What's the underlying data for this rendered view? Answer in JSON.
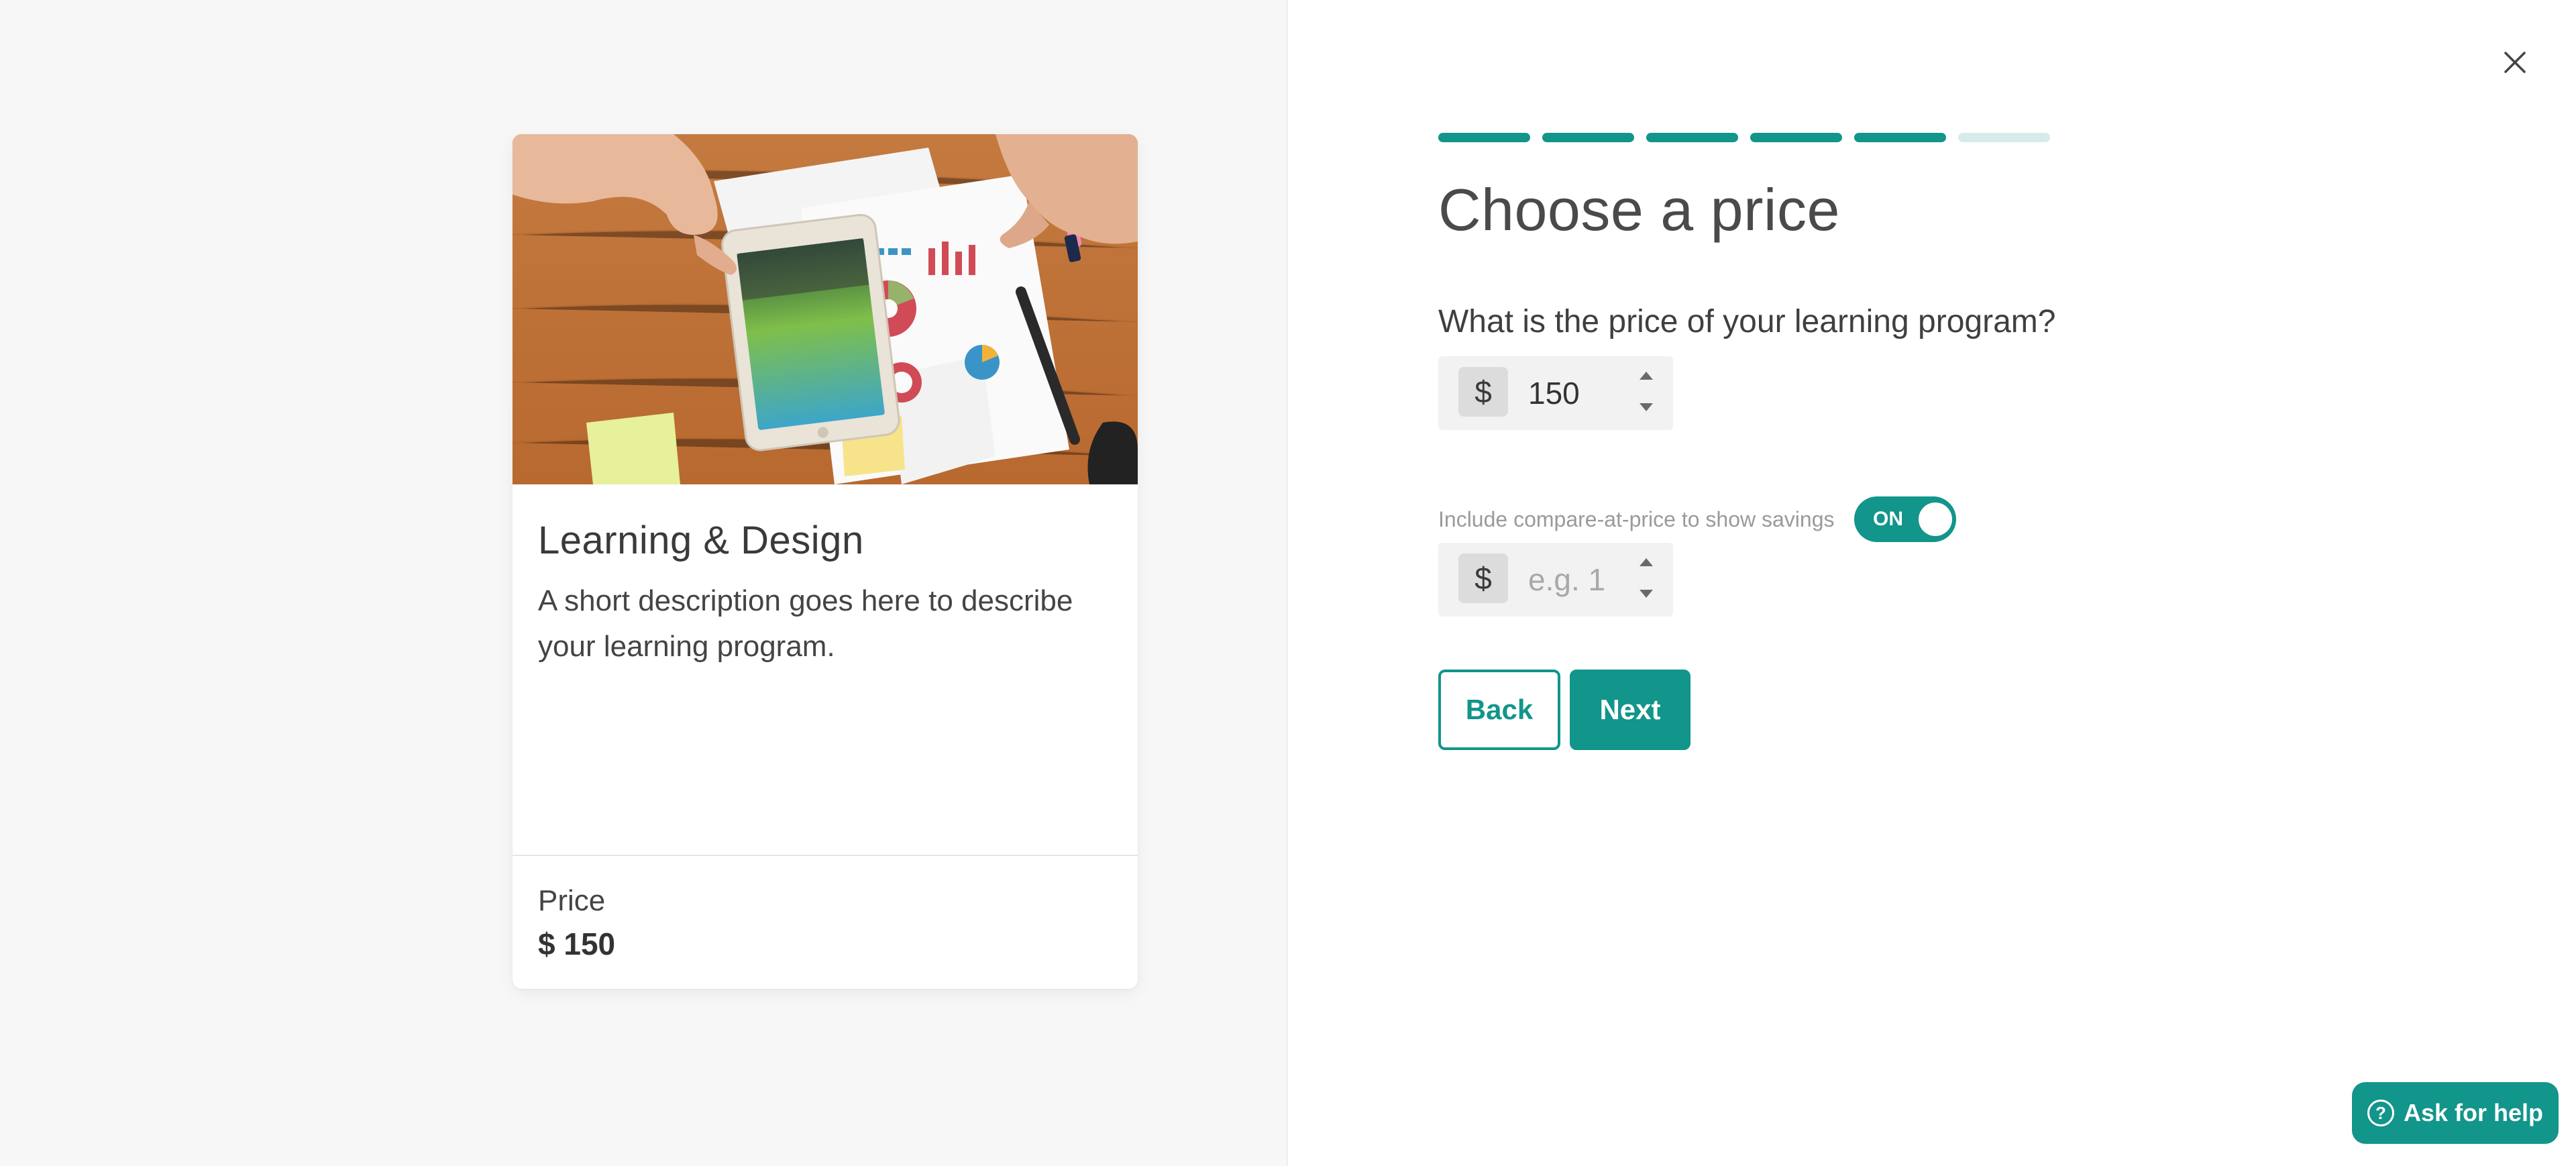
{
  "preview": {
    "image_alt": "Hands holding a Samsung Galaxy Tab over printed charts on a wooden desk",
    "title": "Learning & Design",
    "description": "A short description goes here to describe your learning program.",
    "price_label": "Price",
    "price_value": "$ 150"
  },
  "wizard": {
    "steps_total": 6,
    "steps_completed": 5,
    "heading": "Choose a price",
    "price_question": "What is the price of your learning program?",
    "currency_symbol": "$",
    "price_value": "150",
    "compare_label": "Include compare-at-price to show savings",
    "compare_toggle_state": "ON",
    "compare_placeholder": "e.g. 1",
    "back_label": "Back",
    "next_label": "Next"
  },
  "help": {
    "label": "Ask for help",
    "icon": "?"
  },
  "icons": {
    "close": "close-icon",
    "stepper_up": "triangle-up-icon",
    "stepper_down": "triangle-down-icon",
    "help": "question-circle-icon"
  },
  "colors": {
    "accent": "#12958a",
    "progress_todo": "#d7ebea",
    "left_background": "#f7f7f7",
    "input_background": "#f2f2f2"
  }
}
